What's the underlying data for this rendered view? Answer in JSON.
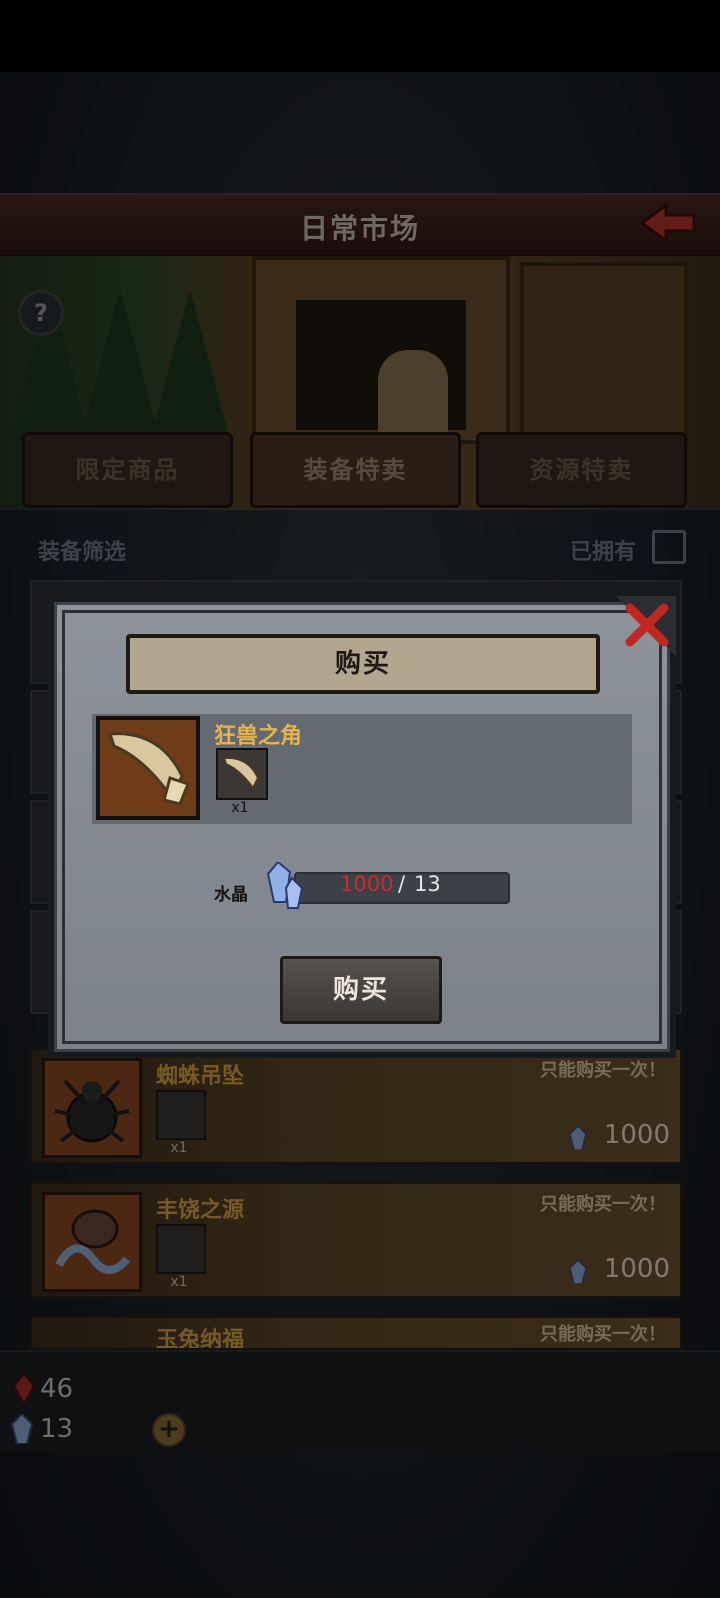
{
  "header": {
    "title": "日常市场"
  },
  "banner": {
    "help": "?",
    "tabs": [
      {
        "label": "限定商品"
      },
      {
        "label": "装备特卖"
      },
      {
        "label": "资源特卖"
      }
    ]
  },
  "filter": {
    "label": "装备筛选",
    "owned_label": "已拥有"
  },
  "items": [
    {
      "name": "蜘蛛吊坠",
      "limit": "只能购买一次！",
      "qty": "x1",
      "price": "1000"
    },
    {
      "name": "丰饶之源",
      "limit": "只能购买一次！",
      "qty": "x1",
      "price": "1000"
    },
    {
      "name": "玉兔纳福",
      "limit": "只能购买一次！"
    }
  ],
  "resources": {
    "gems": "46",
    "crystals": "13",
    "add": "+"
  },
  "modal": {
    "title": "购买",
    "item_name": "狂兽之角",
    "item_qty": "x1",
    "cost_label": "水晶",
    "cost_required": "1000",
    "cost_separator": "/",
    "cost_owned": "13",
    "buy_label": "购买"
  },
  "colors": {
    "accent_gold": "#d9a441",
    "cost_red": "#c62d2d",
    "title_bar": "#4a2a22"
  },
  "icons": [
    "help-icon",
    "back-arrow-icon",
    "checkbox-icon",
    "close-icon",
    "crystal-icon",
    "gem-icon",
    "horn-icon",
    "spider-pendant-icon",
    "vase-icon",
    "plus-icon"
  ]
}
